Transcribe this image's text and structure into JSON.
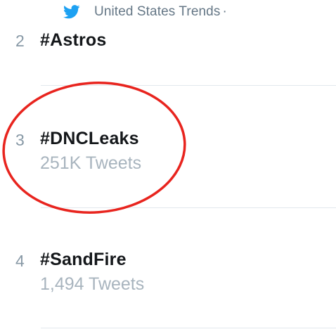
{
  "header": {
    "icon": "twitter-bird-icon",
    "title": "United States Trends",
    "separator": "·"
  },
  "trends": [
    {
      "rank": "2",
      "hashtag": "#Astros",
      "tweets": ""
    },
    {
      "rank": "3",
      "hashtag": "#DNCLeaks",
      "tweets": "251K Tweets"
    },
    {
      "rank": "4",
      "hashtag": "#SandFire",
      "tweets": "1,494 Tweets"
    }
  ],
  "colors": {
    "twitter_blue": "#1da1f2",
    "highlight_circle": "#e8241e",
    "secondary_text": "#a8b4be",
    "divider": "#e1e8ed"
  }
}
